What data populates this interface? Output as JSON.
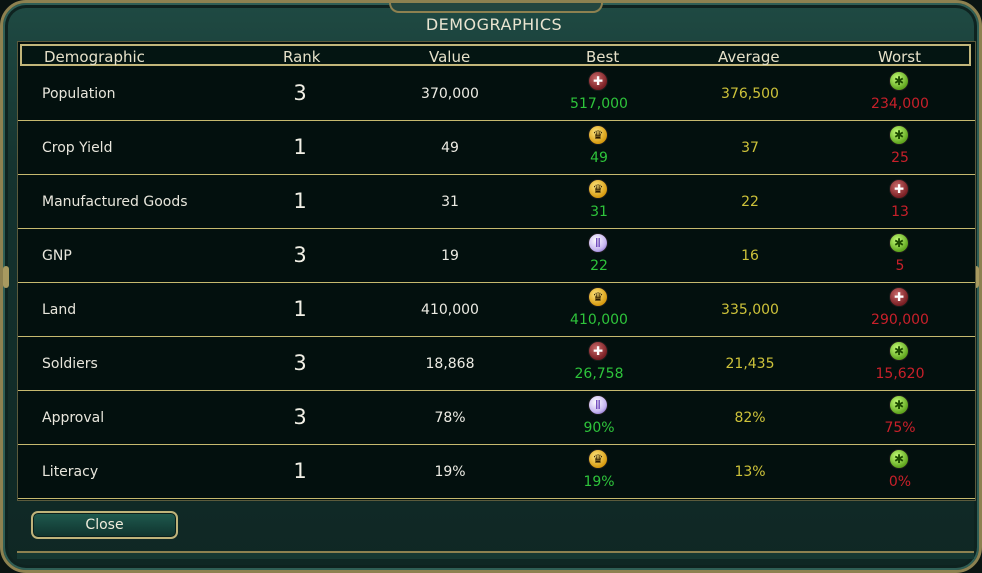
{
  "window": {
    "title": "DEMOGRAPHICS"
  },
  "columns": [
    "Demographic",
    "Rank",
    "Value",
    "Best",
    "Average",
    "Worst"
  ],
  "rows": [
    {
      "name": "Population",
      "rank": "3",
      "value": "370,000",
      "best_icon": "cross-icon",
      "best": "517,000",
      "average": "376,500",
      "worst_icon": "star-icon",
      "worst": "234,000"
    },
    {
      "name": "Crop Yield",
      "rank": "1",
      "value": "49",
      "best_icon": "eagle-icon",
      "best": "49",
      "average": "37",
      "worst_icon": "star-icon",
      "worst": "25"
    },
    {
      "name": "Manufactured Goods",
      "rank": "1",
      "value": "31",
      "best_icon": "eagle-icon",
      "best": "31",
      "average": "22",
      "worst_icon": "cross-icon",
      "worst": "13"
    },
    {
      "name": "GNP",
      "rank": "3",
      "value": "19",
      "best_icon": "arch-icon",
      "best": "22",
      "average": "16",
      "worst_icon": "star-icon",
      "worst": "5"
    },
    {
      "name": "Land",
      "rank": "1",
      "value": "410,000",
      "best_icon": "eagle-icon",
      "best": "410,000",
      "average": "335,000",
      "worst_icon": "cross-icon",
      "worst": "290,000"
    },
    {
      "name": "Soldiers",
      "rank": "3",
      "value": "18,868",
      "best_icon": "cross-icon",
      "best": "26,758",
      "average": "21,435",
      "worst_icon": "star-icon",
      "worst": "15,620"
    },
    {
      "name": "Approval",
      "rank": "3",
      "value": "78%",
      "best_icon": "arch-icon",
      "best": "90%",
      "average": "82%",
      "worst_icon": "star-icon",
      "worst": "75%"
    },
    {
      "name": "Literacy",
      "rank": "1",
      "value": "19%",
      "best_icon": "eagle-icon",
      "best": "19%",
      "average": "13%",
      "worst_icon": "star-icon",
      "worst": "0%"
    }
  ],
  "buttons": {
    "close": "Close"
  },
  "colors": {
    "best": "#2ec43b",
    "average": "#cdc23a",
    "worst": "#c8202a",
    "border": "#c6b96f"
  }
}
